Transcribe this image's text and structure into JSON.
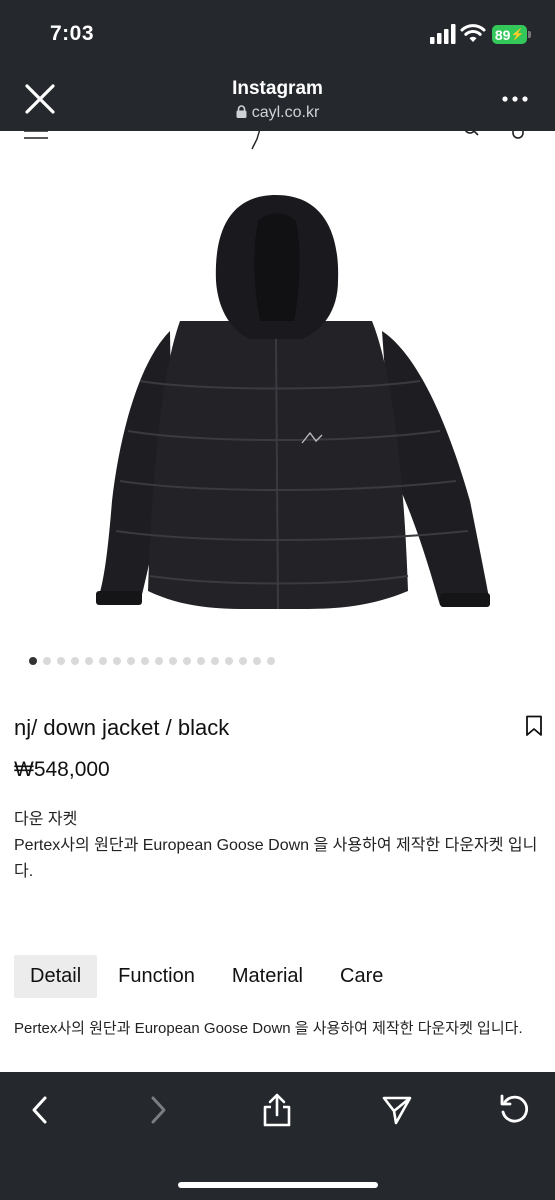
{
  "status_bar": {
    "time": "7:03",
    "battery": "89"
  },
  "browser": {
    "title": "Instagram",
    "url": "cayl.co.kr"
  },
  "carousel": {
    "total": 18,
    "active_index": 0
  },
  "product": {
    "name": "nj/ down jacket / black",
    "price": "₩548,000",
    "desc_title": "다운 자켓",
    "desc_body": "Pertex사의 원단과 European Goose Down 을 사용하여 제작한 다운자켓 입니다."
  },
  "tabs": [
    {
      "label": "Detail",
      "active": true
    },
    {
      "label": "Function",
      "active": false
    },
    {
      "label": "Material",
      "active": false
    },
    {
      "label": "Care",
      "active": false
    }
  ],
  "detail": {
    "text": "Pertex사의 원단과 European Goose Down 을 사용하여 제작한 다운자켓 입니다."
  },
  "colors": {
    "chrome": "#25282d",
    "battery": "#34c759",
    "jacket": "#1e1e22"
  }
}
